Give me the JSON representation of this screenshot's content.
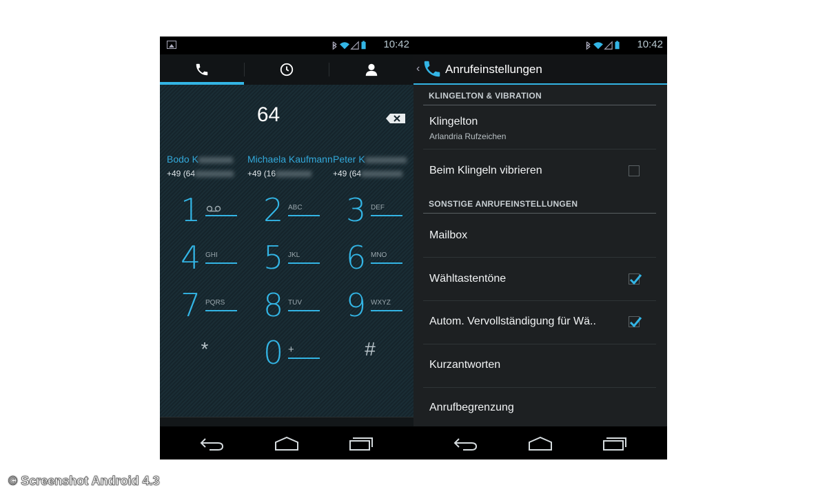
{
  "status": {
    "time_left": "10:42",
    "time_right": "10:42"
  },
  "dialer": {
    "tabs": [
      {
        "icon": "phone-icon",
        "selected": true
      },
      {
        "icon": "clock-icon",
        "selected": false
      },
      {
        "icon": "person-icon",
        "selected": false
      }
    ],
    "digits": "64",
    "suggestions": [
      {
        "name": "Bodo K",
        "number": "+49 (64"
      },
      {
        "name": "Michaela Kaufmann",
        "number": "+49 (16"
      },
      {
        "name": "Peter K",
        "number": "+49 (64"
      }
    ],
    "keys": [
      {
        "num": "1",
        "sub": "voicemail"
      },
      {
        "num": "2",
        "sub": "ABC"
      },
      {
        "num": "3",
        "sub": "DEF"
      },
      {
        "num": "4",
        "sub": "GHI"
      },
      {
        "num": "5",
        "sub": "JKL"
      },
      {
        "num": "6",
        "sub": "MNO"
      },
      {
        "num": "7",
        "sub": "PQRS"
      },
      {
        "num": "8",
        "sub": "TUV"
      },
      {
        "num": "9",
        "sub": "WXYZ"
      },
      {
        "num": "*",
        "sub": ""
      },
      {
        "num": "0",
        "sub": "+"
      },
      {
        "num": "#",
        "sub": ""
      }
    ]
  },
  "settings": {
    "title": "Anrufeinstellungen",
    "section1": "KLINGELTON & VIBRATION",
    "ringtone": {
      "title": "Klingelton",
      "summary": "Arlandria Rufzeichen"
    },
    "vibrate": {
      "title": "Beim Klingeln vibrieren",
      "checked": false
    },
    "section2": "SONSTIGE ANRUFEINSTELLUNGEN",
    "mailbox": "Mailbox",
    "dialtones": {
      "title": "Wähltastentöne",
      "checked": true
    },
    "autocomplete": {
      "title": "Autom. Vervollständigung für Wä..",
      "checked": true
    },
    "quick_responses": "Kurzantworten",
    "call_limit": "Anrufbegrenzung"
  },
  "credit": "© Screenshot Android 4.3",
  "colors": {
    "accent": "#33b5e5"
  }
}
